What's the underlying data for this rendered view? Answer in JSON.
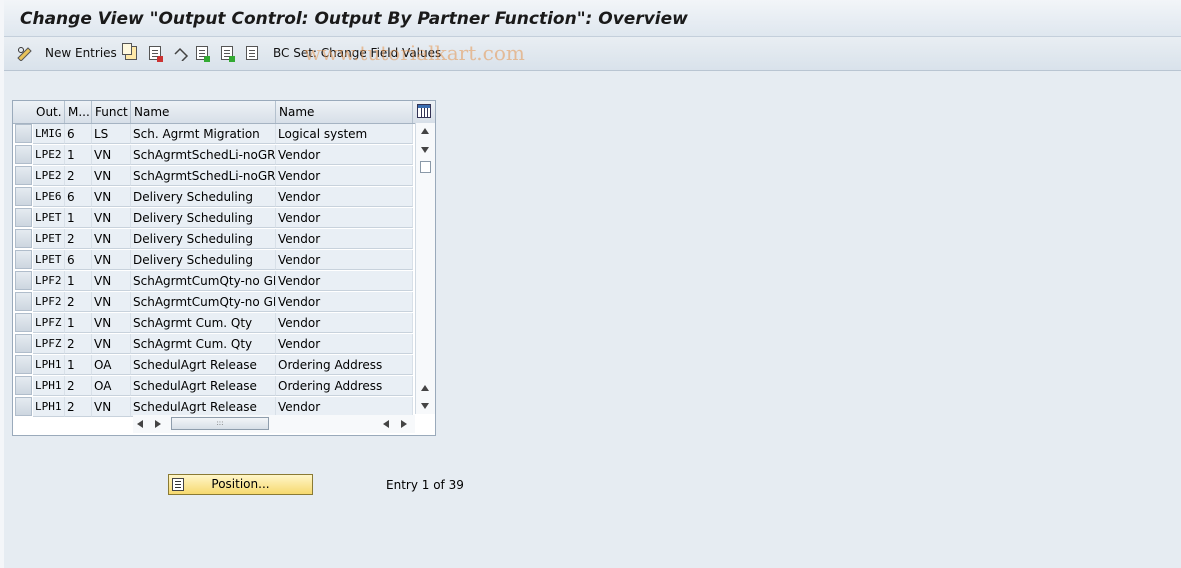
{
  "window": {
    "title": "Change View \"Output Control: Output By Partner Function\": Overview"
  },
  "toolbar": {
    "new_entries_label": "New Entries",
    "bc_set_label": "BC Set: Change Field Values"
  },
  "watermark": "www.tutorialkart.com",
  "table": {
    "columns": [
      "Out.",
      "M...",
      "Funct",
      "Name",
      "Name"
    ],
    "rows": [
      {
        "out": "LMIG",
        "m": "6",
        "funct": "LS",
        "name": "Sch. Agrmt Migration",
        "name2": "Logical system"
      },
      {
        "out": "LPE2",
        "m": "1",
        "funct": "VN",
        "name": "SchAgrmtSchedLi-noGR",
        "name2": "Vendor"
      },
      {
        "out": "LPE2",
        "m": "2",
        "funct": "VN",
        "name": "SchAgrmtSchedLi-noGR",
        "name2": "Vendor"
      },
      {
        "out": "LPE6",
        "m": "6",
        "funct": "VN",
        "name": "Delivery Scheduling",
        "name2": "Vendor"
      },
      {
        "out": "LPET",
        "m": "1",
        "funct": "VN",
        "name": "Delivery Scheduling",
        "name2": "Vendor"
      },
      {
        "out": "LPET",
        "m": "2",
        "funct": "VN",
        "name": "Delivery Scheduling",
        "name2": "Vendor"
      },
      {
        "out": "LPET",
        "m": "6",
        "funct": "VN",
        "name": "Delivery Scheduling",
        "name2": "Vendor"
      },
      {
        "out": "LPF2",
        "m": "1",
        "funct": "VN",
        "name": "SchAgrmtCumQty-no GR",
        "name2": "Vendor"
      },
      {
        "out": "LPF2",
        "m": "2",
        "funct": "VN",
        "name": "SchAgrmtCumQty-no GR",
        "name2": "Vendor"
      },
      {
        "out": "LPFZ",
        "m": "1",
        "funct": "VN",
        "name": "SchAgrmt Cum. Qty",
        "name2": "Vendor"
      },
      {
        "out": "LPFZ",
        "m": "2",
        "funct": "VN",
        "name": "SchAgrmt Cum. Qty",
        "name2": "Vendor"
      },
      {
        "out": "LPH1",
        "m": "1",
        "funct": "OA",
        "name": "SchedulAgrt Release",
        "name2": "Ordering Address"
      },
      {
        "out": "LPH1",
        "m": "2",
        "funct": "OA",
        "name": "SchedulAgrt Release",
        "name2": "Ordering Address"
      },
      {
        "out": "LPH1",
        "m": "2",
        "funct": "VN",
        "name": "SchedulAgrt Release",
        "name2": "Vendor"
      }
    ]
  },
  "footer": {
    "position_label": "Position...",
    "entry_info": "Entry 1 of 39"
  }
}
